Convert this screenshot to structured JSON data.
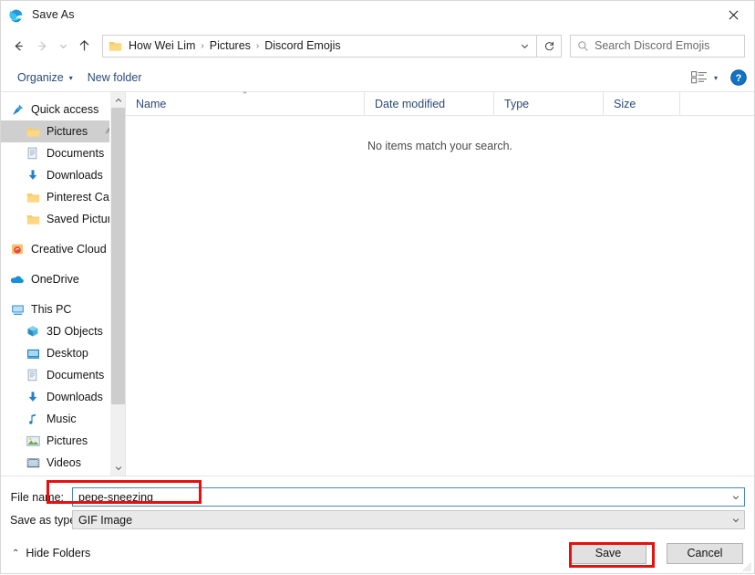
{
  "window": {
    "title": "Save As",
    "app_icon": "edge-logo-icon",
    "close_label": "✕",
    "accent_red": "#e8100f",
    "focus_blue": "#4a8ab0",
    "link_blue": "#2b4a78"
  },
  "nav": {
    "back": "←",
    "forward": "→",
    "recent": "⌄",
    "up": "↑",
    "refresh": "↻",
    "dropdown": "⌄"
  },
  "breadcrumb": {
    "items": [
      "How Wei Lim",
      "Pictures",
      "Discord Emojis"
    ],
    "separator": "›"
  },
  "search": {
    "placeholder": "Search Discord Emojis",
    "icon": "search-icon"
  },
  "toolbar": {
    "organize_label": "Organize",
    "organize_caret": "▾",
    "new_folder_label": "New folder",
    "view_caret": "▾",
    "view_icon": "view-list-icon",
    "help_label": "?"
  },
  "sidebar": {
    "groups": [
      {
        "header": {
          "label": "Quick access",
          "icon": "pin-star-icon",
          "selected": false
        },
        "items": [
          {
            "label": "Pictures",
            "icon": "folder-icon",
            "selected": true,
            "pinned": true,
            "pin_glyph": "📌"
          },
          {
            "label": "Documents",
            "icon": "documents-icon",
            "selected": false
          },
          {
            "label": "Downloads",
            "icon": "download-arrow-icon",
            "selected": false
          },
          {
            "label": "Pinterest Case St",
            "icon": "folder-icon",
            "selected": false
          },
          {
            "label": "Saved Pictures",
            "icon": "folder-icon",
            "selected": false
          }
        ]
      },
      {
        "header": {
          "label": "Creative Cloud Fil",
          "icon": "creative-cloud-icon",
          "selected": false
        },
        "items": []
      },
      {
        "header": {
          "label": "OneDrive",
          "icon": "onedrive-cloud-icon",
          "selected": false
        },
        "items": []
      },
      {
        "header": {
          "label": "This PC",
          "icon": "this-pc-icon",
          "selected": false
        },
        "items": [
          {
            "label": "3D Objects",
            "icon": "3d-objects-icon",
            "selected": false
          },
          {
            "label": "Desktop",
            "icon": "desktop-icon",
            "selected": false
          },
          {
            "label": "Documents",
            "icon": "documents-icon",
            "selected": false
          },
          {
            "label": "Downloads",
            "icon": "download-arrow-icon",
            "selected": false
          },
          {
            "label": "Music",
            "icon": "music-note-icon",
            "selected": false
          },
          {
            "label": "Pictures",
            "icon": "pictures-icon",
            "selected": false
          },
          {
            "label": "Videos",
            "icon": "videos-icon",
            "selected": false
          }
        ]
      }
    ],
    "scroll_up": "⌃",
    "scroll_down": "⌄"
  },
  "filelist": {
    "columns": [
      {
        "label": "Name",
        "sorted": true,
        "sort_caret": "⌃"
      },
      {
        "label": "Date modified",
        "sorted": false
      },
      {
        "label": "Type",
        "sorted": false
      },
      {
        "label": "Size",
        "sorted": false
      }
    ],
    "empty_message": "No items match your search.",
    "rows": []
  },
  "form": {
    "file_name_label": "File name:",
    "file_name_value": "pepe-sneezing",
    "save_as_type_label": "Save as type:",
    "save_as_type_value": "GIF Image",
    "caret": "⌄"
  },
  "footer": {
    "hide_folders_label": "Hide Folders",
    "hide_folders_caret": "⌃",
    "save_label": "Save",
    "cancel_label": "Cancel"
  },
  "annotations": [
    {
      "name": "file-name-highlight",
      "target": "file name field"
    },
    {
      "name": "save-button-highlight",
      "target": "Save button"
    }
  ]
}
